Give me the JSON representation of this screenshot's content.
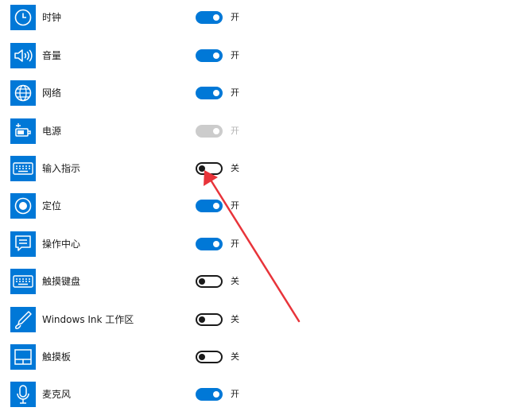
{
  "items": [
    {
      "label": "时钟",
      "state": "开",
      "icon": "clock-icon",
      "toggle": "on"
    },
    {
      "label": "音量",
      "state": "开",
      "icon": "volume-icon",
      "toggle": "on"
    },
    {
      "label": "网络",
      "state": "开",
      "icon": "globe-icon",
      "toggle": "on"
    },
    {
      "label": "电源",
      "state": "开",
      "icon": "power-plug-icon",
      "toggle": "disabled"
    },
    {
      "label": "输入指示",
      "state": "关",
      "icon": "keyboard-icon",
      "toggle": "off"
    },
    {
      "label": "定位",
      "state": "开",
      "icon": "location-icon",
      "toggle": "on"
    },
    {
      "label": "操作中心",
      "state": "开",
      "icon": "action-center-icon",
      "toggle": "on"
    },
    {
      "label": "触摸键盘",
      "state": "关",
      "icon": "touch-keyboard-icon",
      "toggle": "off"
    },
    {
      "label": "Windows Ink 工作区",
      "state": "关",
      "icon": "pen-icon",
      "toggle": "off"
    },
    {
      "label": "触摸板",
      "state": "关",
      "icon": "touchpad-icon",
      "toggle": "off"
    },
    {
      "label": "麦克风",
      "state": "开",
      "icon": "microphone-icon",
      "toggle": "on"
    }
  ],
  "colors": {
    "accent": "#0078d7",
    "annotation": "#e8343a"
  }
}
